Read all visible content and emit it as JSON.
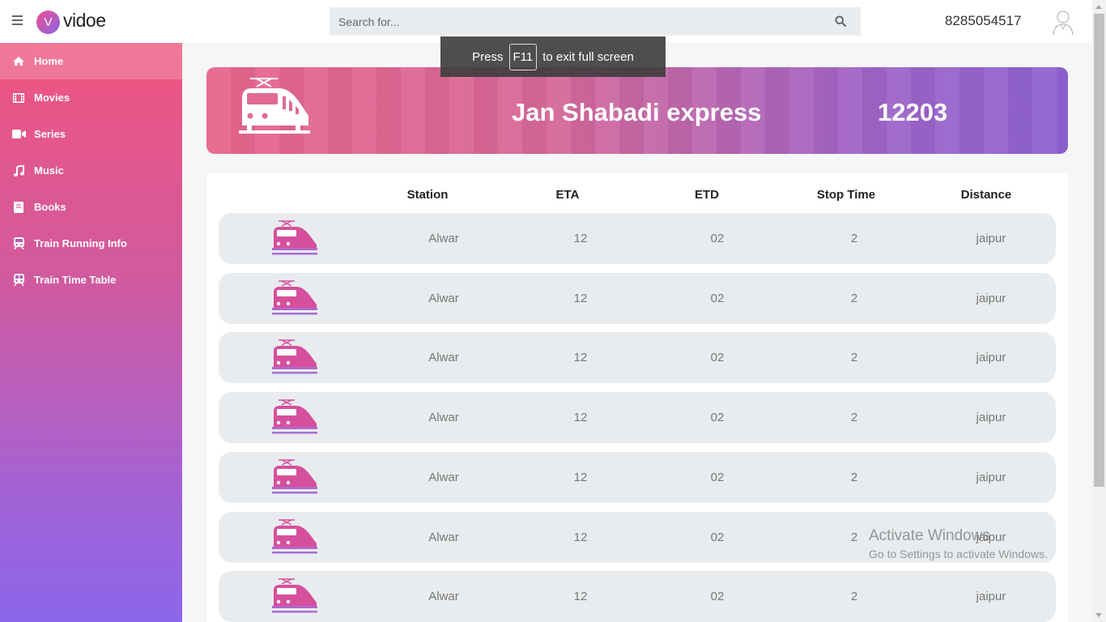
{
  "header": {
    "logo_letter": "V",
    "logo_text": "vidoe",
    "search_placeholder": "Search for...",
    "phone": "8285054517"
  },
  "sidebar": {
    "items": [
      {
        "label": "Home",
        "icon": "home-icon",
        "active": true
      },
      {
        "label": "Movies",
        "icon": "film-icon"
      },
      {
        "label": "Series",
        "icon": "video-camera-icon"
      },
      {
        "label": "Music",
        "icon": "music-note-icon"
      },
      {
        "label": "Books",
        "icon": "book-icon"
      },
      {
        "label": "Train Running Info",
        "icon": "train-icon"
      },
      {
        "label": "Train Time Table",
        "icon": "subway-icon"
      }
    ]
  },
  "fullscreen_notice": {
    "before": "Press",
    "key": "F11",
    "after": "to exit full screen"
  },
  "banner": {
    "train_name": "Jan Shabadi express",
    "train_number": "12203"
  },
  "table": {
    "headers": [
      "Station",
      "ETA",
      "ETD",
      "Stop Time",
      "Distance"
    ],
    "rows": [
      {
        "station": "Alwar",
        "eta": "12",
        "etd": "02",
        "stop_time": "2",
        "distance": "jaipur"
      },
      {
        "station": "Alwar",
        "eta": "12",
        "etd": "02",
        "stop_time": "2",
        "distance": "jaipur"
      },
      {
        "station": "Alwar",
        "eta": "12",
        "etd": "02",
        "stop_time": "2",
        "distance": "jaipur"
      },
      {
        "station": "Alwar",
        "eta": "12",
        "etd": "02",
        "stop_time": "2",
        "distance": "jaipur"
      },
      {
        "station": "Alwar",
        "eta": "12",
        "etd": "02",
        "stop_time": "2",
        "distance": "jaipur"
      },
      {
        "station": "Alwar",
        "eta": "12",
        "etd": "02",
        "stop_time": "2",
        "distance": "jaipur"
      },
      {
        "station": "Alwar",
        "eta": "12",
        "etd": "02",
        "stop_time": "2",
        "distance": "jaipur"
      }
    ]
  },
  "watermark": {
    "line1": "Activate Windows",
    "line2": "Go to Settings to activate Windows."
  },
  "colors": {
    "accent_pink": "#f0557f",
    "accent_purple": "#8c66ea",
    "row_bg": "#e9ecee",
    "train_icon": "#d64f9c"
  }
}
